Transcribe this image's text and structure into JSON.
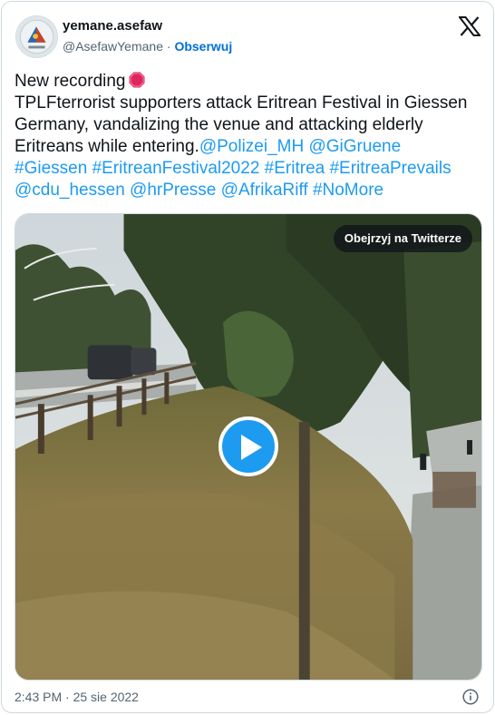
{
  "author": {
    "display_name": "yemane.asefaw",
    "handle": "@AsefawYemane",
    "separator": " · ",
    "follow_label": "Obserwuj",
    "avatar_icon": "profile-avatar-icon"
  },
  "platform_icon": "x-logo-icon",
  "tweet": {
    "line1": "New recording",
    "line1_emoji": "stop-sign-icon",
    "line2": "TPLFterrorist supporters attack Eritrean Festival in Giessen",
    "line3": "Germany, vandalizing the venue and attacking elderly",
    "line4_text": "Eritreans while entering.",
    "mention_polizei": "@Polizei_MH",
    "mention_gigruene": "@GiGruene",
    "hashtag_giessen": "#Giessen",
    "hashtag_festival": "#EritreanFestival2022",
    "hashtag_eritrea": "#Eritrea",
    "hashtag_prevails": "#EritreaPrevails",
    "mention_cdu": "@cdu_hessen",
    "mention_hr": "@hrPresse",
    "mention_afrika": "@AfrikaRiff",
    "hashtag_nomore": "#NoMore"
  },
  "media": {
    "watch_label": "Obejrzyj na Twitterze",
    "play_icon": "play-icon"
  },
  "footer": {
    "timestamp": "2:43 PM · 25 sie 2022",
    "info_icon": "info-icon"
  },
  "colors": {
    "link": "#1d9bf0",
    "follow": "#006fd6",
    "secondary_text": "#536471",
    "border": "#cfd9de",
    "play_button": "#1d9bf0"
  }
}
